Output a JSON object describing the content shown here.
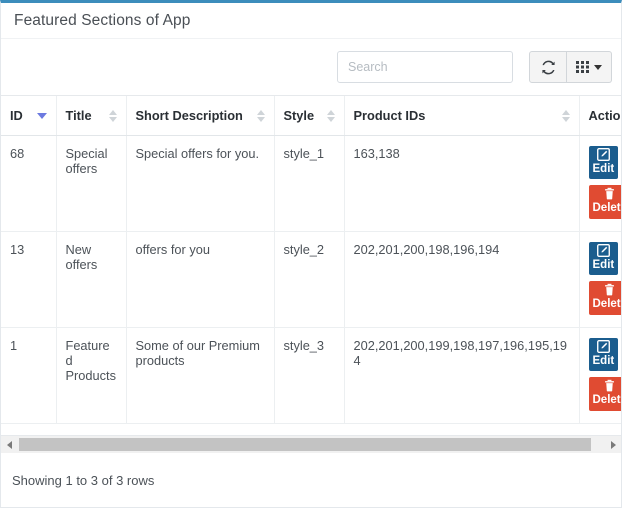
{
  "accent_color": "#3c8dbc",
  "panel": {
    "title": "Featured Sections of App"
  },
  "toolbar": {
    "search_placeholder": "Search",
    "search_value": "",
    "refresh_label": "refresh-icon",
    "columns_label": "columns-grid-icon"
  },
  "table": {
    "columns": [
      {
        "key": "id",
        "label": "ID",
        "sort": "desc"
      },
      {
        "key": "title",
        "label": "Title",
        "sort": "none"
      },
      {
        "key": "desc",
        "label": "Short Description",
        "sort": "none"
      },
      {
        "key": "style",
        "label": "Style",
        "sort": "none"
      },
      {
        "key": "pids",
        "label": "Product IDs",
        "sort": "none"
      },
      {
        "key": "act",
        "label": "Action",
        "sort": "none"
      }
    ],
    "rows": [
      {
        "id": "68",
        "title": "Special offers",
        "desc": "Special offers for you.",
        "style": "style_1",
        "pids": "163,138",
        "edit_label": "Edit",
        "delete_label": "Delete"
      },
      {
        "id": "13",
        "title": "New offers",
        "desc": "offers for you",
        "style": "style_2",
        "pids": "202,201,200,198,196,194",
        "edit_label": "Edit",
        "delete_label": "Delete"
      },
      {
        "id": "1",
        "title": "Featured Products",
        "desc": "Some of our Premium products",
        "style": "style_3",
        "pids": "202,201,200,199,198,197,196,195,194",
        "edit_label": "Edit",
        "delete_label": "Delete"
      }
    ]
  },
  "footer": {
    "status": "Showing 1 to 3 of 3 rows"
  }
}
